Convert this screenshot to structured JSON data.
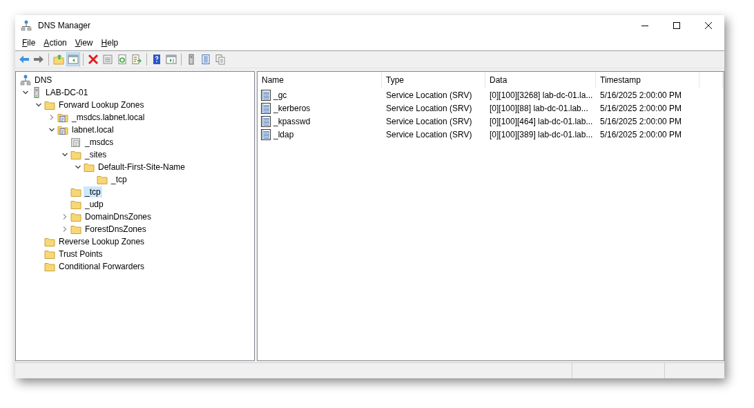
{
  "window": {
    "title": "DNS Manager"
  },
  "menu": [
    {
      "label": "File"
    },
    {
      "label": "Action"
    },
    {
      "label": "View"
    },
    {
      "label": "Help"
    }
  ],
  "toolbar": [
    {
      "kind": "back",
      "pressed": false
    },
    {
      "kind": "forward",
      "pressed": false
    },
    {
      "kind": "separator"
    },
    {
      "kind": "up",
      "pressed": false
    },
    {
      "kind": "tree",
      "pressed": true
    },
    {
      "kind": "separator"
    },
    {
      "kind": "delete",
      "pressed": false
    },
    {
      "kind": "properties",
      "pressed": false
    },
    {
      "kind": "refresh",
      "pressed": false
    },
    {
      "kind": "export",
      "pressed": false
    },
    {
      "kind": "separator"
    },
    {
      "kind": "help",
      "pressed": false
    },
    {
      "kind": "pane",
      "pressed": false
    },
    {
      "kind": "separator"
    },
    {
      "kind": "server",
      "pressed": false
    },
    {
      "kind": "list",
      "pressed": false
    },
    {
      "kind": "copy",
      "pressed": false
    }
  ],
  "tree": {
    "label": "DNS",
    "kind": "dns",
    "selected": false,
    "children": [
      {
        "label": "LAB-DC-01",
        "kind": "server",
        "expanded": true,
        "selected": false,
        "children": [
          {
            "label": "Forward Lookup Zones",
            "kind": "folder",
            "expanded": true,
            "selected": false,
            "children": [
              {
                "label": "_msdcs.labnet.local",
                "kind": "zone",
                "expanded": false,
                "selected": false
              },
              {
                "label": "labnet.local",
                "kind": "zone",
                "expanded": true,
                "selected": false,
                "children": [
                  {
                    "label": "_msdcs",
                    "kind": "delegation",
                    "selected": false
                  },
                  {
                    "label": "_sites",
                    "kind": "folder",
                    "expanded": true,
                    "selected": false,
                    "children": [
                      {
                        "label": "Default-First-Site-Name",
                        "kind": "folder",
                        "expanded": true,
                        "selected": false,
                        "children": [
                          {
                            "label": "_tcp",
                            "kind": "folder",
                            "selected": false
                          }
                        ]
                      }
                    ]
                  },
                  {
                    "label": "_tcp",
                    "kind": "folder",
                    "selected": true
                  },
                  {
                    "label": "_udp",
                    "kind": "folder",
                    "selected": false
                  },
                  {
                    "label": "DomainDnsZones",
                    "kind": "folder",
                    "expanded": false,
                    "selected": false
                  },
                  {
                    "label": "ForestDnsZones",
                    "kind": "folder",
                    "expanded": false,
                    "selected": false
                  }
                ]
              }
            ]
          },
          {
            "label": "Reverse Lookup Zones",
            "kind": "folder",
            "selected": false
          },
          {
            "label": "Trust Points",
            "kind": "folder",
            "selected": false
          },
          {
            "label": "Conditional Forwarders",
            "kind": "folder",
            "selected": false
          }
        ]
      }
    ]
  },
  "table": {
    "columns": [
      "Name",
      "Type",
      "Data",
      "Timestamp"
    ],
    "rows": [
      {
        "name": "_gc",
        "type": "Service Location (SRV)",
        "data": "[0][100][3268] lab-dc-01.la...",
        "timestamp": "5/16/2025 2:00:00 PM"
      },
      {
        "name": "_kerberos",
        "type": "Service Location (SRV)",
        "data": "[0][100][88] lab-dc-01.lab...",
        "timestamp": "5/16/2025 2:00:00 PM"
      },
      {
        "name": "_kpasswd",
        "type": "Service Location (SRV)",
        "data": "[0][100][464] lab-dc-01.lab...",
        "timestamp": "5/16/2025 2:00:00 PM"
      },
      {
        "name": "_ldap",
        "type": "Service Location (SRV)",
        "data": "[0][100][389] lab-dc-01.lab...",
        "timestamp": "5/16/2025 2:00:00 PM"
      }
    ]
  }
}
